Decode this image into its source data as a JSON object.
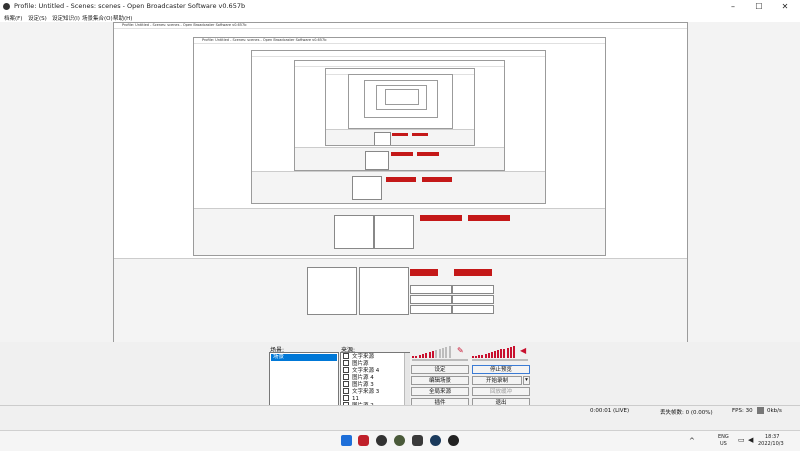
{
  "window": {
    "title": "Profile: Untitled - Scenes: scenes - Open Broadcaster Software v0.657b",
    "controls": {
      "minimize": "–",
      "maximize": "☐",
      "close": "✕"
    }
  },
  "menu": [
    "档案(F)",
    "设定(S)",
    "设定知识(I)",
    "场景集合(O)",
    "帮助(H)"
  ],
  "nested_titles": [
    "Profile: Untitled - Scenes: scenes - Open Broadcaster Software v0.657b",
    "Profile: Untitled - Scenes: scenes - Open Broadcaster Software v0.657b"
  ],
  "scenes": {
    "title": "场景:",
    "items": [
      "场景"
    ]
  },
  "sources": {
    "title": "来源:",
    "items": [
      "文字来源",
      "图片源",
      "文字来源 4",
      "图片源 4",
      "图片源 3",
      "文字来源 3",
      "11",
      "图片源 2"
    ]
  },
  "buttons": {
    "settings": "设定",
    "stop_preview": "停止预览",
    "edit_scene": "编辑场景",
    "start_recording": "开始录制",
    "global_sources": "全局来源",
    "replay_buffer": "回放缓冲",
    "plugins": "插件",
    "exit": "退出"
  },
  "status": {
    "time": "0:00:01 (LIVE)",
    "dropped": "丢失帧数: 0 (0.00%)",
    "fps": "FPS: 30",
    "kbps": "0kb/s"
  },
  "taskbar": {
    "lang_top": "ENG",
    "lang_bottom": "US",
    "time": "18:37",
    "date": "2022/10/3"
  },
  "colors": {
    "accent": "#0078d7",
    "meter_red": "#c8102e",
    "meter_gray": "#bdbdbd"
  }
}
